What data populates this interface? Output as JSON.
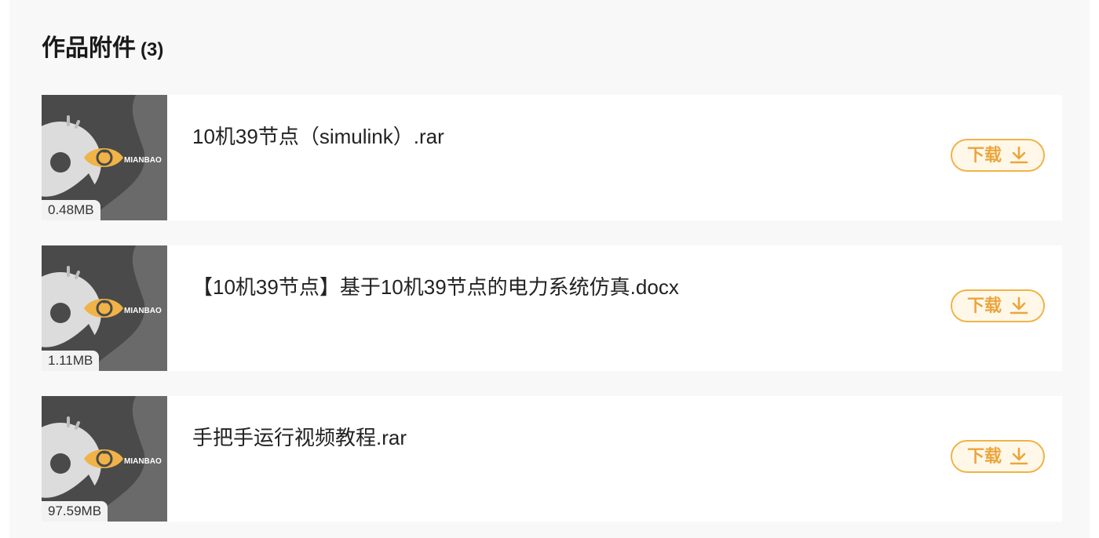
{
  "section": {
    "title": "作品附件",
    "count": "(3)"
  },
  "attachments": [
    {
      "name": "10机39节点（simulink）.rar",
      "size": "0.48MB",
      "download_label": "下载",
      "logo_text": "MIANBAO"
    },
    {
      "name": "【10机39节点】基于10机39节点的电力系统仿真.docx",
      "size": "1.11MB",
      "download_label": "下载",
      "logo_text": "MIANBAO"
    },
    {
      "name": "手把手运行视频教程.rar",
      "size": "97.59MB",
      "download_label": "下载",
      "logo_text": "MIANBAO"
    }
  ],
  "colors": {
    "accent": "#f0b347",
    "accent_text": "#eba53c",
    "panel_bg": "#f8f8f8",
    "thumb_dark": "#4a4a4a"
  },
  "icons": {
    "download": "download-icon",
    "thumbnail": "mianbao-logo-icon"
  }
}
